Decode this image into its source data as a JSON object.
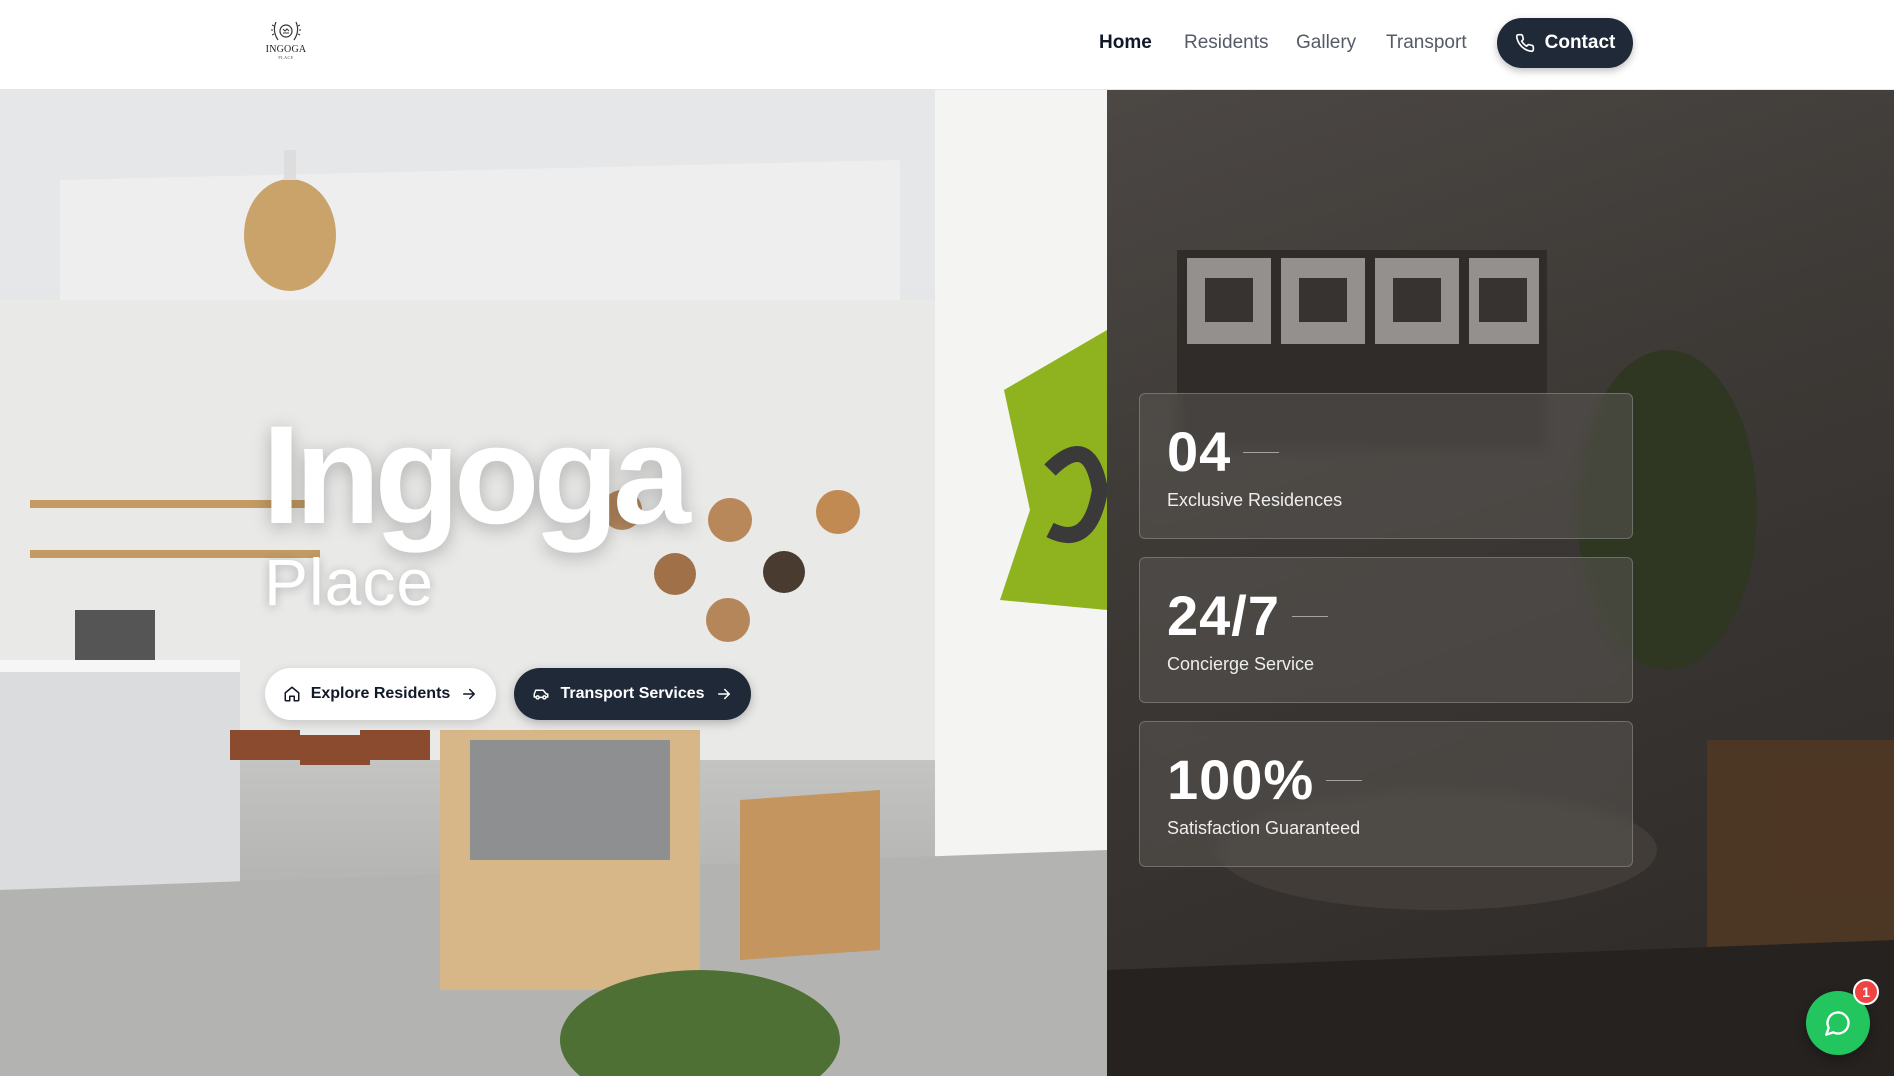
{
  "header": {
    "logo": {
      "name": "INGOGA",
      "sub": "PLACE",
      "icon": "crest-logo-icon"
    },
    "nav": [
      {
        "label": "Home",
        "active": true
      },
      {
        "label": "Residents",
        "active": false
      },
      {
        "label": "Gallery",
        "active": false
      },
      {
        "label": "Transport",
        "active": false
      }
    ],
    "contact": {
      "label": "Contact",
      "icon": "phone-icon"
    }
  },
  "hero": {
    "title": "Ingoga",
    "subtitle": "Place",
    "buttons": {
      "explore": {
        "label": "Explore Residents",
        "icon": "home-icon",
        "trailing_icon": "arrow-right-icon"
      },
      "transport": {
        "label": "Transport Services",
        "icon": "car-icon",
        "trailing_icon": "arrow-right-icon"
      }
    }
  },
  "stats": [
    {
      "value": "04",
      "label": "Exclusive Residences"
    },
    {
      "value": "24/7",
      "label": "Concierge Service"
    },
    {
      "value": "100%",
      "label": "Satisfaction Guaranteed"
    }
  ],
  "chat": {
    "badge": "1",
    "icon": "chat-bubble-icon",
    "color": "#22c55e"
  },
  "colors": {
    "primary_dark": "#1f2937",
    "accent_green": "#22c55e",
    "badge_red": "#ef4444"
  }
}
